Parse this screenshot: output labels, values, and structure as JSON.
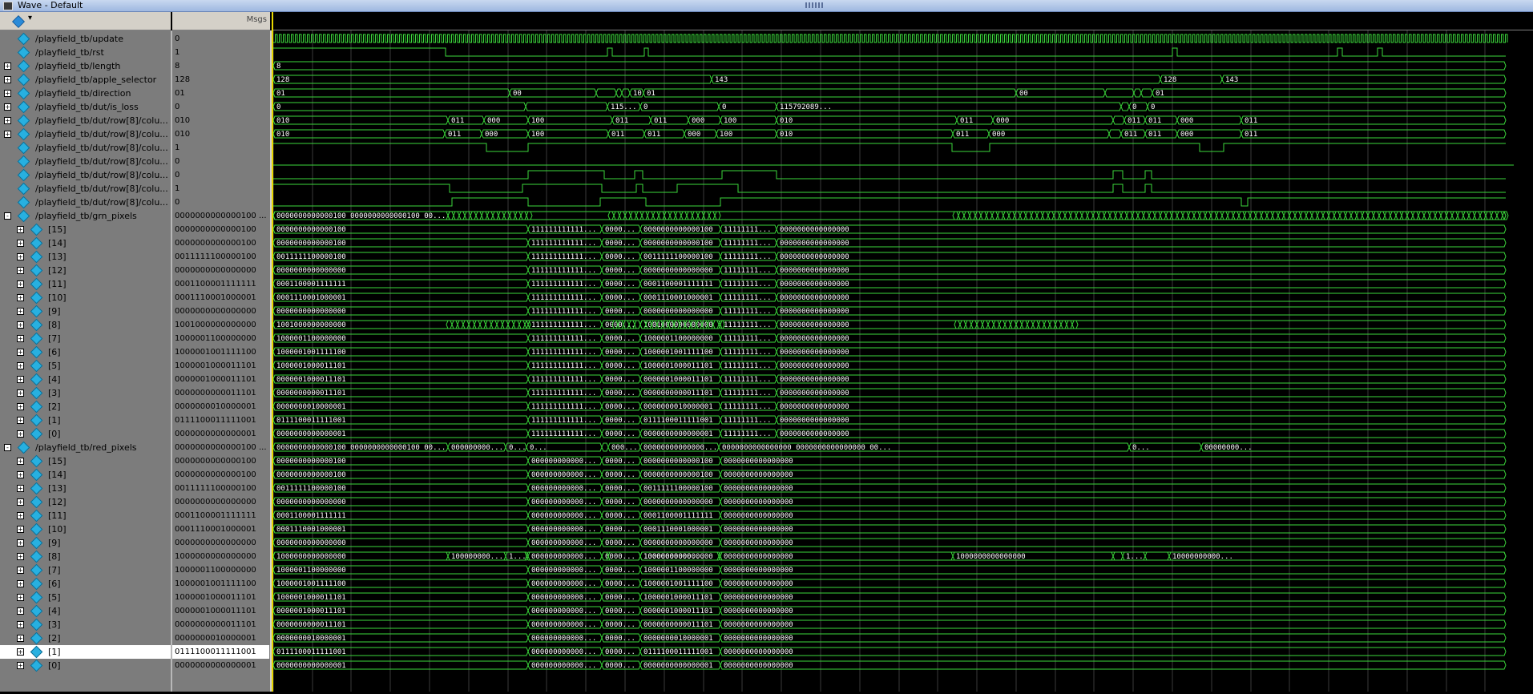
{
  "window": {
    "title": "Wave - Default"
  },
  "header": {
    "msgs_label": "Msgs"
  },
  "signals": [
    {
      "name": "/playfield_tb/update",
      "value": "0",
      "type": "bit",
      "indent": 0,
      "expander": ""
    },
    {
      "name": "/playfield_tb/rst",
      "value": "1",
      "type": "bit",
      "indent": 0,
      "expander": ""
    },
    {
      "name": "/playfield_tb/length",
      "value": "8",
      "type": "bus",
      "indent": 0,
      "expander": "+"
    },
    {
      "name": "/playfield_tb/apple_selector",
      "value": "128",
      "type": "bus",
      "indent": 0,
      "expander": "+"
    },
    {
      "name": "/playfield_tb/direction",
      "value": "01",
      "type": "bus",
      "indent": 0,
      "expander": "+"
    },
    {
      "name": "/playfield_tb/dut/is_loss",
      "value": "0",
      "type": "bus",
      "indent": 0,
      "expander": "+"
    },
    {
      "name": "/playfield_tb/dut/row[8]/colu...",
      "value": "010",
      "type": "bus",
      "indent": 0,
      "expander": "+"
    },
    {
      "name": "/playfield_tb/dut/row[8]/colu...",
      "value": "010",
      "type": "bus",
      "indent": 0,
      "expander": "+"
    },
    {
      "name": "/playfield_tb/dut/row[8]/colu...",
      "value": "1",
      "type": "bit",
      "indent": 0,
      "expander": ""
    },
    {
      "name": "/playfield_tb/dut/row[8]/colu...",
      "value": "0",
      "type": "bit",
      "indent": 0,
      "expander": ""
    },
    {
      "name": "/playfield_tb/dut/row[8]/colu...",
      "value": "0",
      "type": "bit",
      "indent": 0,
      "expander": ""
    },
    {
      "name": "/playfield_tb/dut/row[8]/colu...",
      "value": "1",
      "type": "bit",
      "indent": 0,
      "expander": ""
    },
    {
      "name": "/playfield_tb/dut/row[8]/colu...",
      "value": "0",
      "type": "bit",
      "indent": 0,
      "expander": ""
    },
    {
      "name": "/playfield_tb/grn_pixels",
      "value": "0000000000000100 ...",
      "type": "bus",
      "indent": 0,
      "expander": "-"
    },
    {
      "name": "[15]",
      "value": "0000000000000100",
      "type": "bus",
      "indent": 1,
      "expander": "+"
    },
    {
      "name": "[14]",
      "value": "0000000000000100",
      "type": "bus",
      "indent": 1,
      "expander": "+"
    },
    {
      "name": "[13]",
      "value": "0011111100000100",
      "type": "bus",
      "indent": 1,
      "expander": "+"
    },
    {
      "name": "[12]",
      "value": "0000000000000000",
      "type": "bus",
      "indent": 1,
      "expander": "+"
    },
    {
      "name": "[11]",
      "value": "0001100001111111",
      "type": "bus",
      "indent": 1,
      "expander": "+"
    },
    {
      "name": "[10]",
      "value": "0001110001000001",
      "type": "bus",
      "indent": 1,
      "expander": "+"
    },
    {
      "name": "[9]",
      "value": "0000000000000000",
      "type": "bus",
      "indent": 1,
      "expander": "+"
    },
    {
      "name": "[8]",
      "value": "1001000000000000",
      "type": "bus",
      "indent": 1,
      "expander": "+"
    },
    {
      "name": "[7]",
      "value": "1000001100000000",
      "type": "bus",
      "indent": 1,
      "expander": "+"
    },
    {
      "name": "[6]",
      "value": "1000001001111100",
      "type": "bus",
      "indent": 1,
      "expander": "+"
    },
    {
      "name": "[5]",
      "value": "1000001000011101",
      "type": "bus",
      "indent": 1,
      "expander": "+"
    },
    {
      "name": "[4]",
      "value": "0000001000011101",
      "type": "bus",
      "indent": 1,
      "expander": "+"
    },
    {
      "name": "[3]",
      "value": "0000000000011101",
      "type": "bus",
      "indent": 1,
      "expander": "+"
    },
    {
      "name": "[2]",
      "value": "0000000010000001",
      "type": "bus",
      "indent": 1,
      "expander": "+"
    },
    {
      "name": "[1]",
      "value": "0111100011111001",
      "type": "bus",
      "indent": 1,
      "expander": "+"
    },
    {
      "name": "[0]",
      "value": "0000000000000001",
      "type": "bus",
      "indent": 1,
      "expander": "+"
    },
    {
      "name": "/playfield_tb/red_pixels",
      "value": "0000000000000100 ...",
      "type": "bus",
      "indent": 0,
      "expander": "-"
    },
    {
      "name": "[15]",
      "value": "0000000000000100",
      "type": "bus",
      "indent": 1,
      "expander": "+"
    },
    {
      "name": "[14]",
      "value": "0000000000000100",
      "type": "bus",
      "indent": 1,
      "expander": "+"
    },
    {
      "name": "[13]",
      "value": "0011111100000100",
      "type": "bus",
      "indent": 1,
      "expander": "+"
    },
    {
      "name": "[12]",
      "value": "0000000000000000",
      "type": "bus",
      "indent": 1,
      "expander": "+"
    },
    {
      "name": "[11]",
      "value": "0001100001111111",
      "type": "bus",
      "indent": 1,
      "expander": "+"
    },
    {
      "name": "[10]",
      "value": "0001110001000001",
      "type": "bus",
      "indent": 1,
      "expander": "+"
    },
    {
      "name": "[9]",
      "value": "0000000000000000",
      "type": "bus",
      "indent": 1,
      "expander": "+"
    },
    {
      "name": "[8]",
      "value": "1000000000000000",
      "type": "bus",
      "indent": 1,
      "expander": "+"
    },
    {
      "name": "[7]",
      "value": "1000001100000000",
      "type": "bus",
      "indent": 1,
      "expander": "+"
    },
    {
      "name": "[6]",
      "value": "1000001001111100",
      "type": "bus",
      "indent": 1,
      "expander": "+"
    },
    {
      "name": "[5]",
      "value": "1000001000011101",
      "type": "bus",
      "indent": 1,
      "expander": "+"
    },
    {
      "name": "[4]",
      "value": "0000001000011101",
      "type": "bus",
      "indent": 1,
      "expander": "+"
    },
    {
      "name": "[3]",
      "value": "0000000000011101",
      "type": "bus",
      "indent": 1,
      "expander": "+"
    },
    {
      "name": "[2]",
      "value": "0000000010000001",
      "type": "bus",
      "indent": 1,
      "expander": "+"
    },
    {
      "name": "[1]",
      "value": "0111100011111001",
      "type": "bus",
      "indent": 1,
      "expander": "+",
      "selected": true
    },
    {
      "name": "[0]",
      "value": "0000000000000001",
      "type": "bus",
      "indent": 1,
      "expander": "+"
    }
  ],
  "wave_labels": {
    "length": [
      "8"
    ],
    "apple_selector": [
      "128",
      "143",
      "128",
      "143"
    ],
    "direction": [
      "01",
      "00",
      "10",
      "01",
      "00",
      "10",
      "01"
    ],
    "is_loss": [
      "0",
      "115792089237316...",
      "0",
      "0",
      "115792089...",
      "0",
      "0",
      "0"
    ],
    "col_a": [
      "010",
      "011",
      "000",
      "100",
      "011",
      "011",
      "000",
      "100",
      "010",
      "011",
      "000",
      "011",
      "011",
      "000",
      "011"
    ],
    "col_b": [
      "010",
      "011",
      "000",
      "100",
      "011",
      "011",
      "000",
      "100",
      "010",
      "011",
      "000",
      "011",
      "011",
      "000",
      "011"
    ],
    "grn_top": [
      "0000000000000100 0000000000000100 00111111...",
      "1111111111111111...",
      "11111111...",
      "0000000000000000 0000000000000000 000000000..."
    ],
    "red_top": [
      "0000000000000100 0000000000000100 00111111...",
      "000000000000...",
      "0...",
      "0...",
      "0000000000000000",
      "00000000...",
      "00000000000000000000 0000000000000000 000000...",
      "0000000000000000 0000000000000000 00...",
      "0...",
      "00000000...",
      "00000000..."
    ],
    "ones": "1111111111111111",
    "zeros": "0000000000000000",
    "trunc_ones": "11111111...",
    "r8_a": "10000000000...",
    "r8_b": "1000000000000000",
    "r8_c": "10000000000...",
    "short_1": "1...",
    "short_0": "0...",
    "g8": "1001000000000000",
    "g8_t": "0000000...",
    "g_t1": "0000...",
    "g_t2": "0001...",
    "g_t3": "0011...",
    "g_t4": "1000...",
    "g_t5": "0111..."
  },
  "colors": {
    "wave_green": "#3bd93b",
    "bus_green": "#3bd93b",
    "cursor": "#e8d800",
    "grid": "#3a3a3a",
    "pane": "#7c7c7c",
    "selected": "#ffffff",
    "icon": "#27b0e0"
  }
}
